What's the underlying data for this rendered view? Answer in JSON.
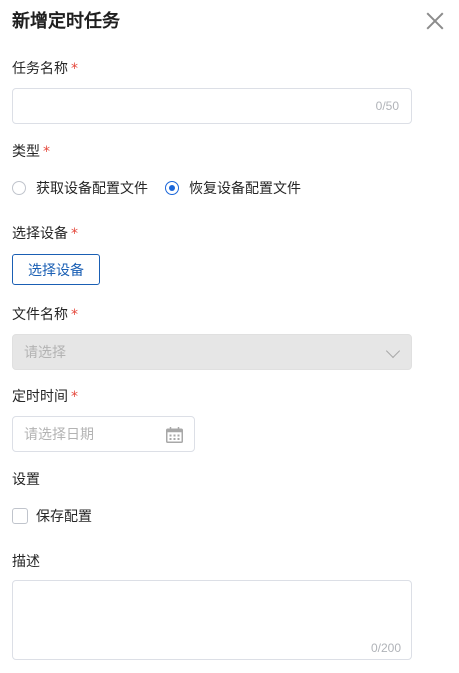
{
  "dialog": {
    "title": "新增定时任务"
  },
  "task_name": {
    "label": "任务名称",
    "required_mark": "*",
    "value": "",
    "counter": "0/50"
  },
  "type": {
    "label": "类型",
    "required_mark": "*",
    "options": [
      {
        "label": "获取设备配置文件",
        "selected": false
      },
      {
        "label": "恢复设备配置文件",
        "selected": true
      }
    ]
  },
  "device": {
    "label": "选择设备",
    "required_mark": "*",
    "button_label": "选择设备"
  },
  "file_name": {
    "label": "文件名称",
    "required_mark": "*",
    "placeholder": "请选择"
  },
  "schedule_time": {
    "label": "定时时间",
    "required_mark": "*",
    "placeholder": "请选择日期"
  },
  "settings": {
    "label": "设置",
    "checkbox_label": "保存配置",
    "checked": false
  },
  "description": {
    "label": "描述",
    "value": "",
    "counter": "0/200"
  },
  "colors": {
    "primary": "#1a66d9",
    "required": "#e5483c",
    "disabled_bg": "#e6e6e6",
    "border": "#dcdfe6"
  }
}
